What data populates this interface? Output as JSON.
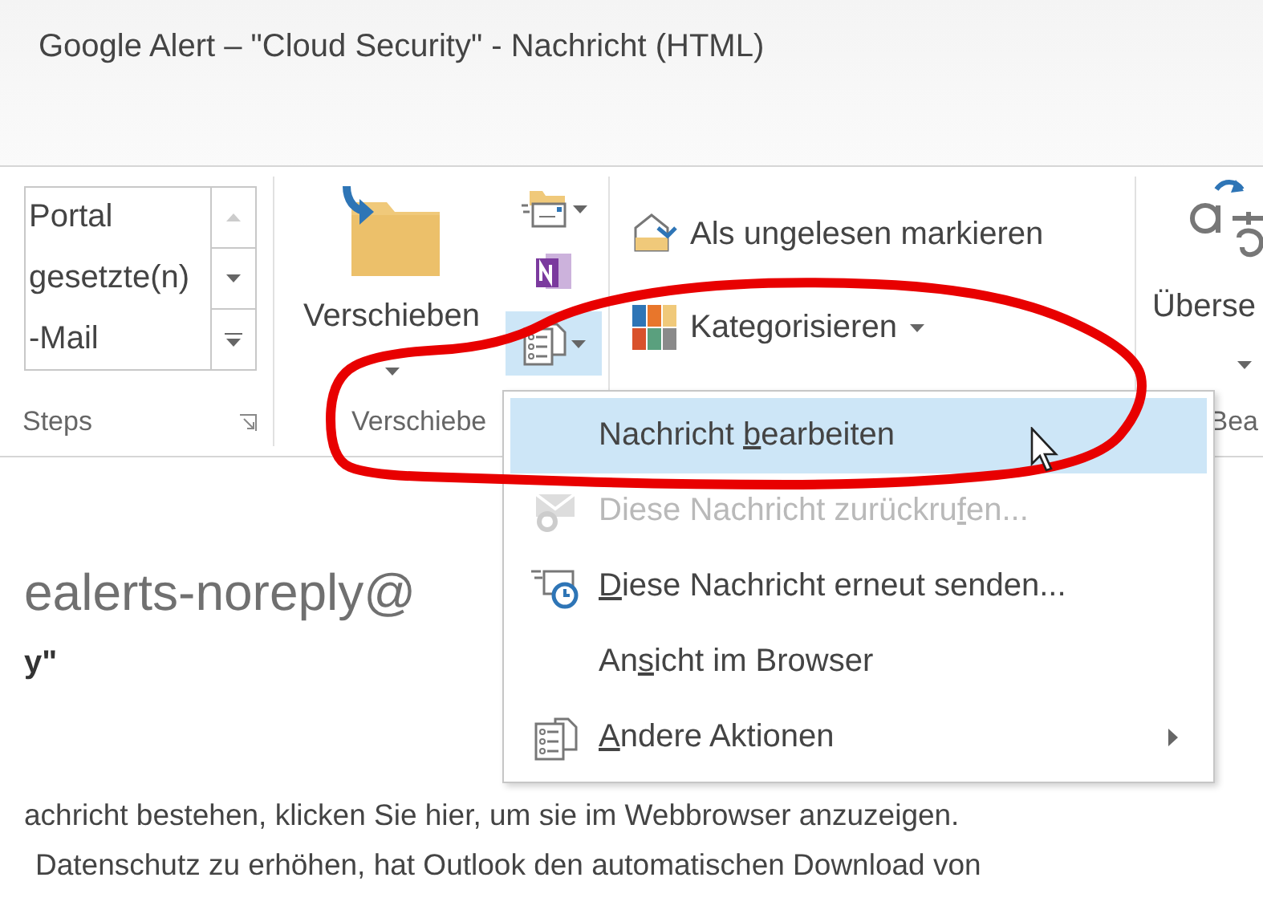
{
  "window": {
    "title": "Google Alert – \"Cloud Security\" - Nachricht (HTML)"
  },
  "ribbon": {
    "quick_steps": {
      "items": [
        "Portal",
        "gesetzte(n)",
        "-Mail"
      ],
      "label": "Steps"
    },
    "move": {
      "button": "Verschieben",
      "label": "Verschiebe",
      "actions_pressed": true
    },
    "tags": {
      "buttons": [
        {
          "kind": "unread",
          "label": "Als ungelesen markieren",
          "has_menu": false
        },
        {
          "kind": "categorize",
          "label": "Kategorisieren",
          "has_menu": true
        }
      ]
    },
    "translate": {
      "button": "Überse",
      "label": "Bea"
    }
  },
  "menu": {
    "items": [
      {
        "kind": "edit",
        "label": {
          "before": "Nachricht ",
          "key": "b",
          "after": "earbeiten"
        },
        "selected": true,
        "disabled": false,
        "submenu": false
      },
      {
        "kind": "recall",
        "label": {
          "before": "Diese Nachricht zurückru",
          "key": "f",
          "after": "en..."
        },
        "selected": false,
        "disabled": true,
        "submenu": false
      },
      {
        "kind": "resend",
        "label": {
          "key": "D",
          "after": "iese Nachricht erneut senden..."
        },
        "selected": false,
        "disabled": false,
        "submenu": false
      },
      {
        "kind": "browser",
        "label": {
          "before": "An",
          "key": "s",
          "after": "icht im Browser"
        },
        "selected": false,
        "disabled": false,
        "submenu": false
      },
      {
        "kind": "more",
        "label": {
          "key": "A",
          "after": "ndere Aktionen"
        },
        "selected": false,
        "disabled": false,
        "submenu": true
      }
    ]
  },
  "message": {
    "sender": "ealerts-noreply@",
    "subject": "y\"",
    "lines": [
      "achricht bestehen, klicken Sie hier, um sie im Webbrowser anzuzeigen.",
      "Datenschutz zu erhöhen, hat Outlook den automatischen Download von"
    ]
  }
}
